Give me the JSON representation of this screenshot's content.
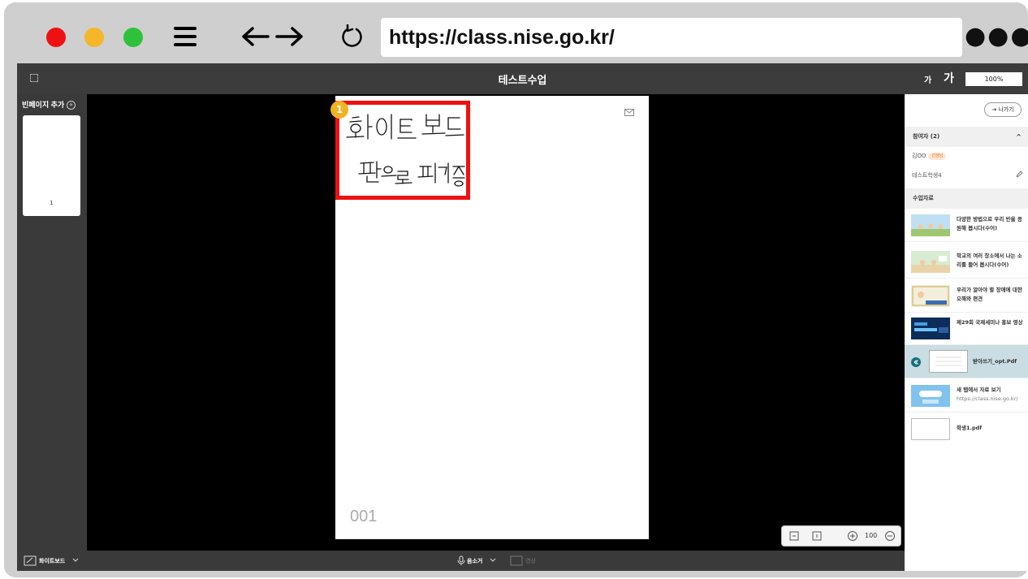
{
  "browser": {
    "url": "https://class.nise.go.kr/",
    "more_label": "●●●"
  },
  "app": {
    "title": "테스트수업",
    "font_small_label": "가",
    "font_large_label": "가",
    "zoom_value": "100%"
  },
  "left_panel": {
    "add_page_label": "빈페이지 추가",
    "thumbnail_page_number": "1"
  },
  "board": {
    "badge_number": "1",
    "page_number": "001",
    "handwriting_line1": "화이트 보드",
    "handwriting_line2": "펜으로 필기 중",
    "zoom_value": "100"
  },
  "bottom_bar": {
    "whiteboard_label": "화이트보드",
    "mic_label": "음소거",
    "camera_label": "영상"
  },
  "right_panel": {
    "leave_label": "나가기",
    "participants_header": "참여자 (2)",
    "participants": [
      {
        "name": "김OO",
        "tag": "선생님"
      },
      {
        "name": "테스트학생4"
      }
    ],
    "materials_header": "수업자료",
    "materials": [
      {
        "title": "다양한 방법으로 우리 반을 응원해 봅시다(수어)"
      },
      {
        "title": "학교의 여러 장소에서 나는 소리를 들어 봅시다(수어)"
      },
      {
        "title": "우리가 알아야 할 장애에 대한 오해와 편견"
      },
      {
        "title": "제29회 국제세미나 홍보 영상"
      },
      {
        "title": "받아쓰기_opt.Pdf"
      },
      {
        "title": "새 탭에서 자료 보기",
        "subtitle": "https://class.nise.go.kr/"
      },
      {
        "title": "학생1.pdf"
      }
    ]
  },
  "colors": {
    "highlight_red": "#ee1111",
    "badge_orange": "#f0b323",
    "selected_row": "#c9dde2",
    "collapse_teal": "#16707e"
  }
}
